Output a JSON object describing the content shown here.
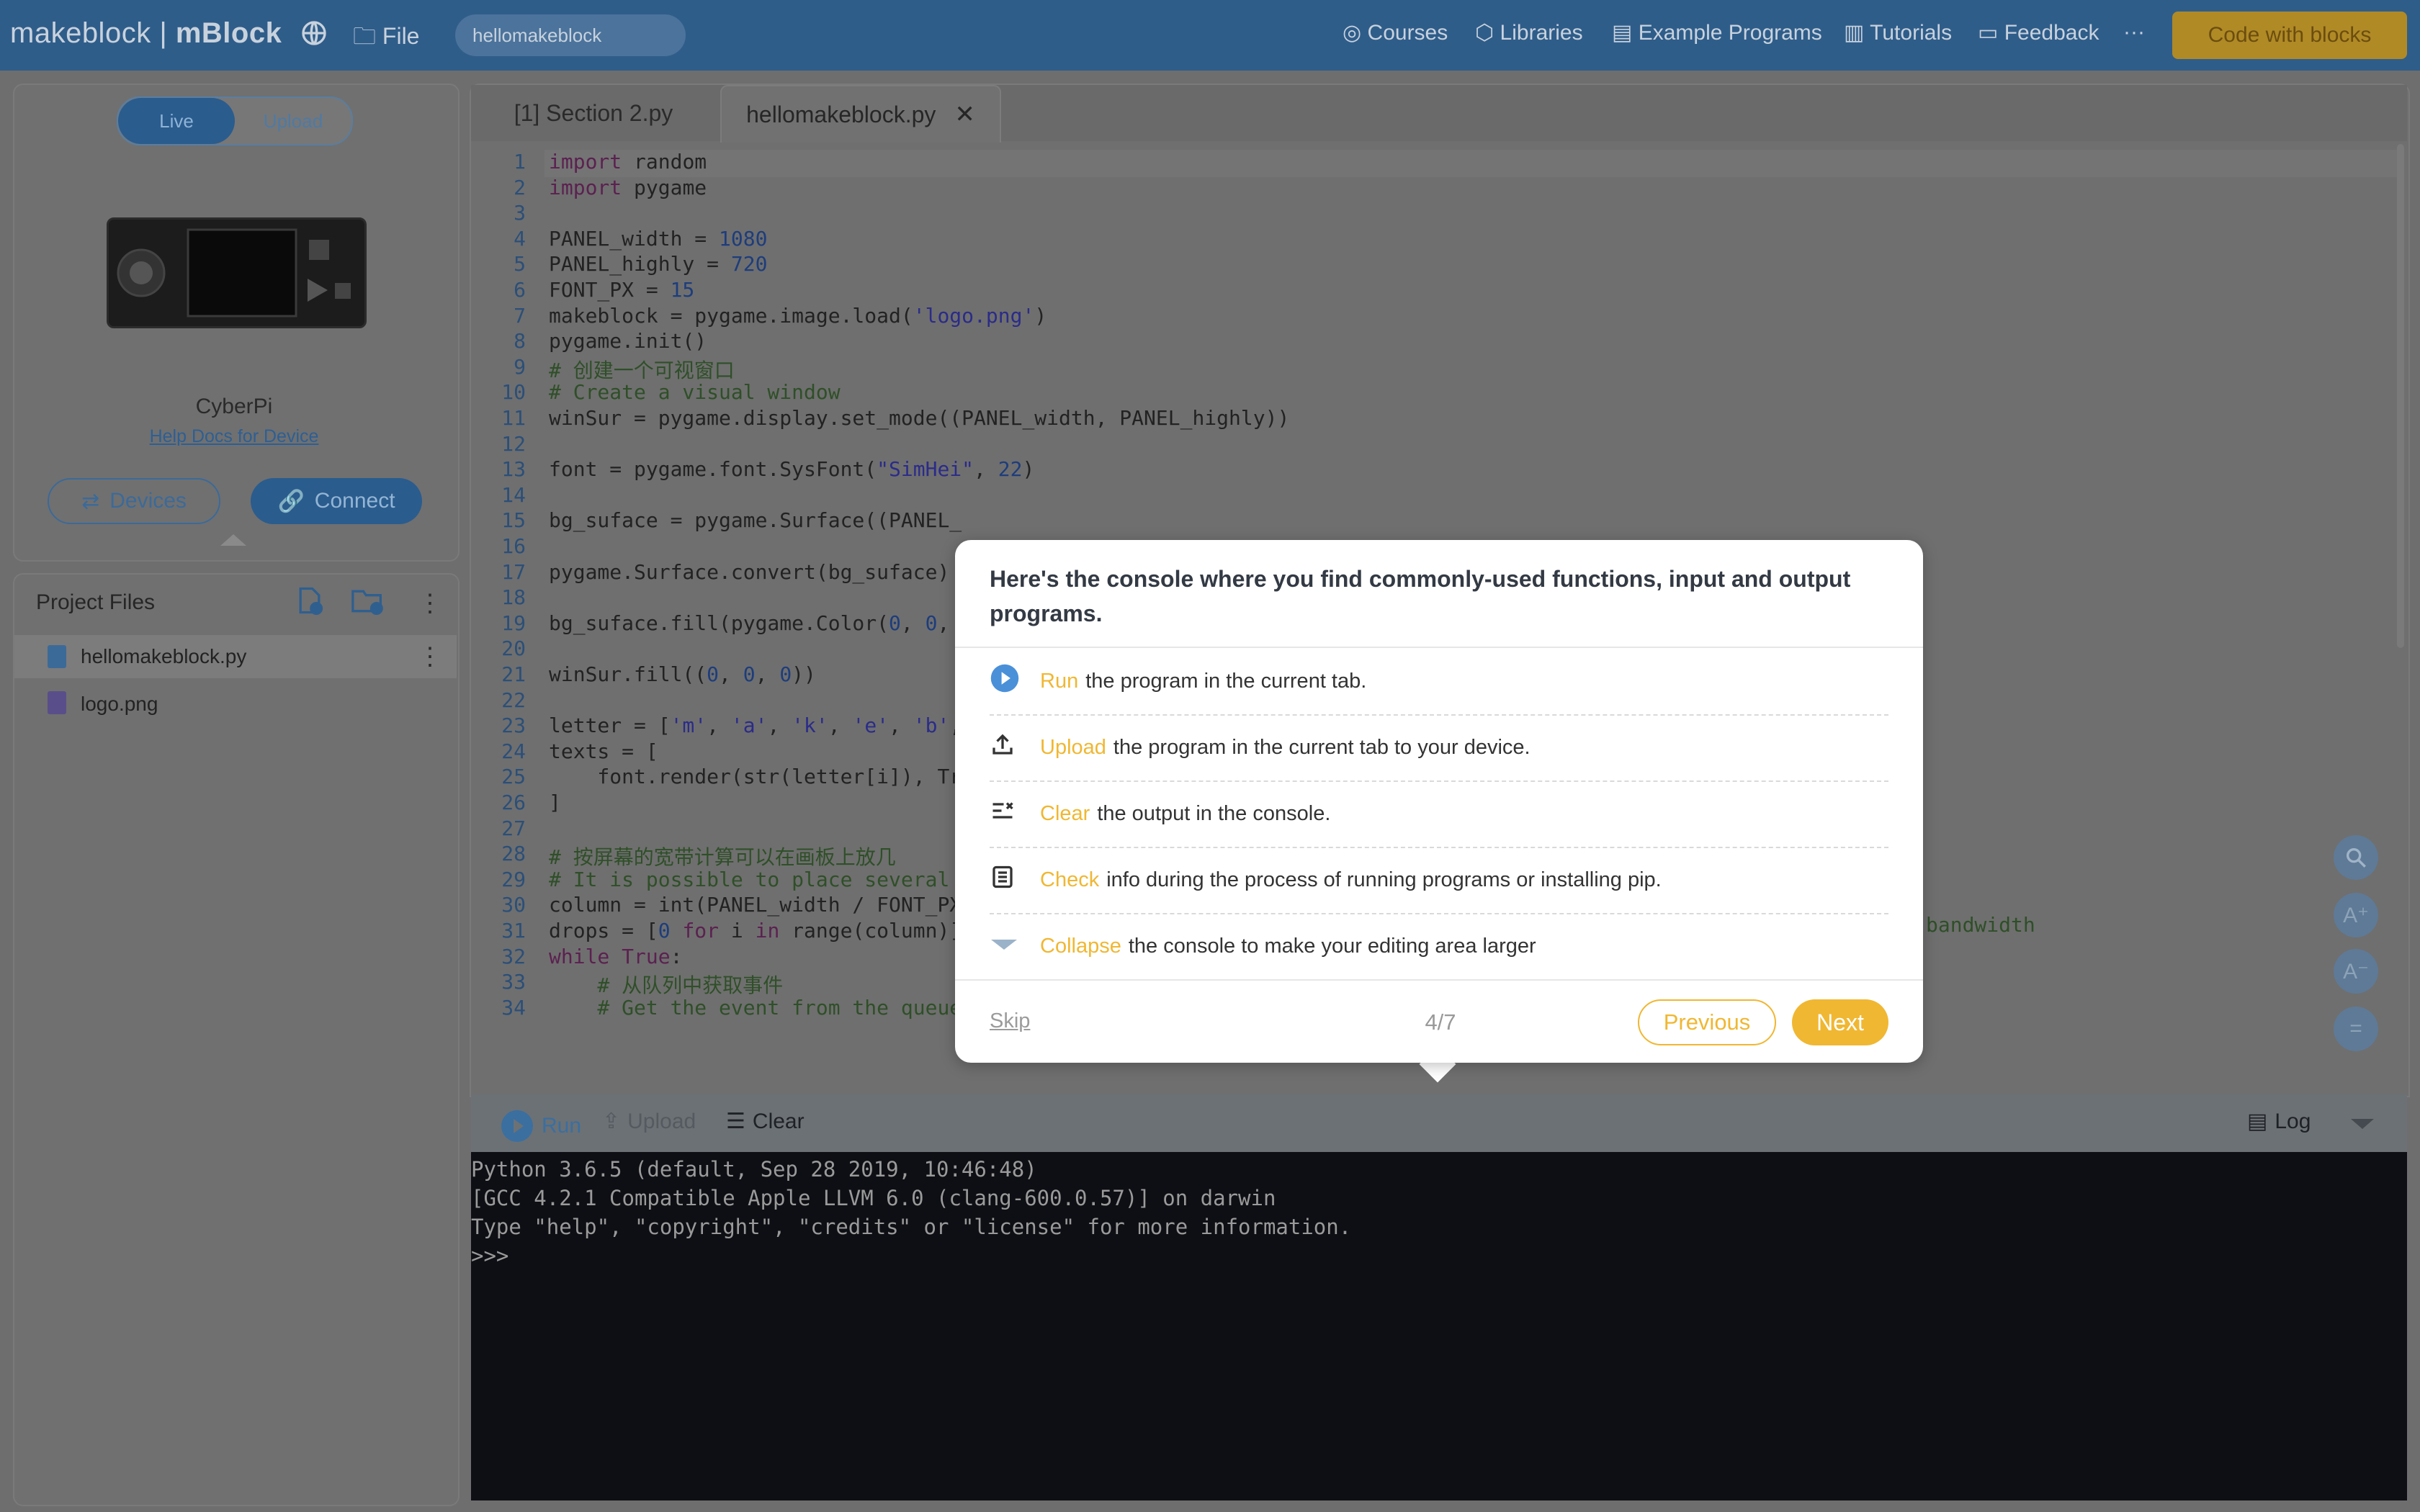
{
  "header": {
    "brand": "makeblock",
    "separator": "|",
    "product": "mBlock",
    "file_label": "File",
    "project_name": "hellomakeblock",
    "nav": [
      "Courses",
      "Libraries",
      "Example Programs",
      "Tutorials",
      "Feedback"
    ],
    "more": "···",
    "code_with_blocks": "Code with blocks"
  },
  "device": {
    "mode_live": "Live",
    "mode_upload": "Upload",
    "name": "CyberPi",
    "help_docs": "Help Docs for Device",
    "devices_button": "Devices",
    "connect_button": "Connect"
  },
  "project_files": {
    "title": "Project Files",
    "files": [
      "hellomakeblock.py",
      "logo.png"
    ]
  },
  "editor": {
    "tabs": [
      "[1] Section 2.py",
      "hellomakeblock.py"
    ],
    "code_lines": [
      "import random",
      "import pygame",
      "",
      "PANEL_width = 1080",
      "PANEL_highly = 720",
      "FONT_PX = 15",
      "makeblock = pygame.image.load('logo.png')",
      "pygame.init()",
      "# 创建一个可视窗口",
      "# Create a visual window",
      "winSur = pygame.display.set_mode((PANEL_width, PANEL_highly))",
      "",
      "font = pygame.font.SysFont(\"SimHei\", 22)",
      "",
      "bg_suface = pygame.Surface((PANEL_",
      "",
      "pygame.Surface.convert(bg_suface)",
      "",
      "bg_suface.fill(pygame.Color(0, 0,",
      "",
      "winSur.fill((0, 0, 0))",
      "",
      "letter = ['m', 'a', 'k', 'e', 'b',",
      "texts = [",
      "    font.render(str(letter[i]), Tr",
      "]",
      "",
      "# 按屏幕的宽带计算可以在画板上放几",
      "# It is possible to place several",
      "column = int(PANEL_width / FONT_PX",
      "drops = [0 for i in range(column)]",
      "while True:",
      "    # 从队列中获取事件",
      "    # Get the event from the queue"
    ],
    "line29_tail": "bandwidth"
  },
  "console": {
    "run": "Run",
    "upload": "Upload",
    "clear": "Clear",
    "log": "Log",
    "output": "Python 3.6.5 (default, Sep 28 2019, 10:46:48)\n[GCC 4.2.1 Compatible Apple LLVM 6.0 (clang-600.0.57)] on darwin\nType \"help\", \"copyright\", \"credits\" or \"license\" for more information.\n>>>"
  },
  "tour": {
    "title": "Here's the console where you find commonly-used functions, input and output programs.",
    "items": [
      {
        "keyword": "Run",
        "text": "the program in the current tab."
      },
      {
        "keyword": "Upload",
        "text": "the program in the current tab to your device."
      },
      {
        "keyword": "Clear",
        "text": "the output in the console."
      },
      {
        "keyword": "Check",
        "text": "info during the process of running programs or installing pip."
      },
      {
        "keyword": "Collapse",
        "text": "the console to make your editing area larger"
      }
    ],
    "skip": "Skip",
    "step": "4/7",
    "previous": "Previous",
    "next": "Next"
  },
  "colors": {
    "header_bg": "#2f5d8a",
    "accent_blue": "#4a90d9",
    "tour_yellow": "#f0b732",
    "console_bg": "#0e0f14"
  }
}
